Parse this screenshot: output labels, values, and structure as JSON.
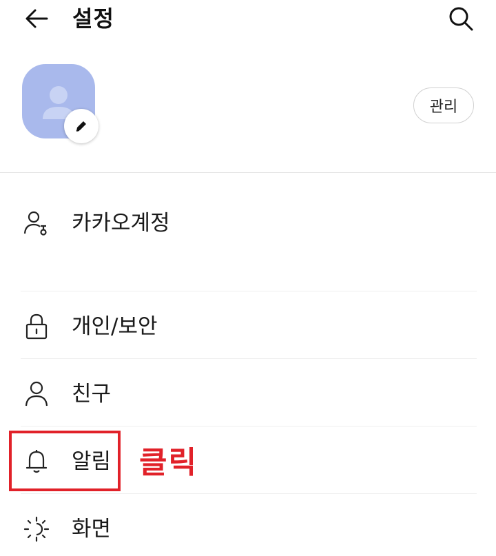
{
  "header": {
    "title": "설정"
  },
  "profile": {
    "manage_label": "관리"
  },
  "menu": [
    {
      "label": "카카오계정",
      "icon": "account-key-icon"
    },
    {
      "label": "개인/보안",
      "icon": "lock-icon"
    },
    {
      "label": "친구",
      "icon": "person-icon"
    },
    {
      "label": "알림",
      "icon": "bell-icon"
    },
    {
      "label": "화면",
      "icon": "brightness-icon"
    }
  ],
  "annotation": {
    "text": "클릭",
    "color": "#e12129"
  },
  "colors": {
    "avatar_bg": "#a9b9ec",
    "highlight": "#e12129"
  }
}
